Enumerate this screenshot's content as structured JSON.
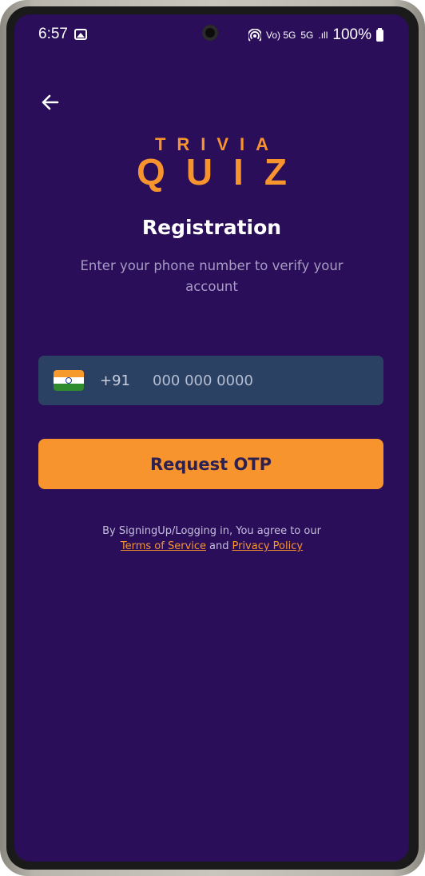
{
  "status_bar": {
    "time": "6:57",
    "battery": "100%",
    "icons": [
      "gallery-icon",
      "hotspot-icon",
      "volte-icon",
      "5g-icon",
      "signal-icon",
      "battery-icon"
    ],
    "volte_label": "Vo) 5G",
    "fiveg_label": "5G",
    "signal_label": ".ıll"
  },
  "header": {
    "back_icon": "arrow-left-icon"
  },
  "logo": {
    "top": "TRIVIA",
    "bottom": "QUIZ"
  },
  "page": {
    "title": "Registration",
    "subtitle": "Enter your phone number to verify your account"
  },
  "phone_field": {
    "flag": "india-flag-icon",
    "country_code": "+91",
    "placeholder": "000 000 0000",
    "value": ""
  },
  "actions": {
    "request_otp_label": "Request OTP"
  },
  "legal": {
    "prefix": "By SigningUp/Logging in, You agree to our",
    "terms_label": "Terms of Service",
    "and_label": "and",
    "privacy_label": "Privacy Policy"
  },
  "colors": {
    "background": "#2a0e5a",
    "accent": "#f7942e",
    "field_bg": "#2b4163",
    "subtitle": "#a89cc4"
  }
}
